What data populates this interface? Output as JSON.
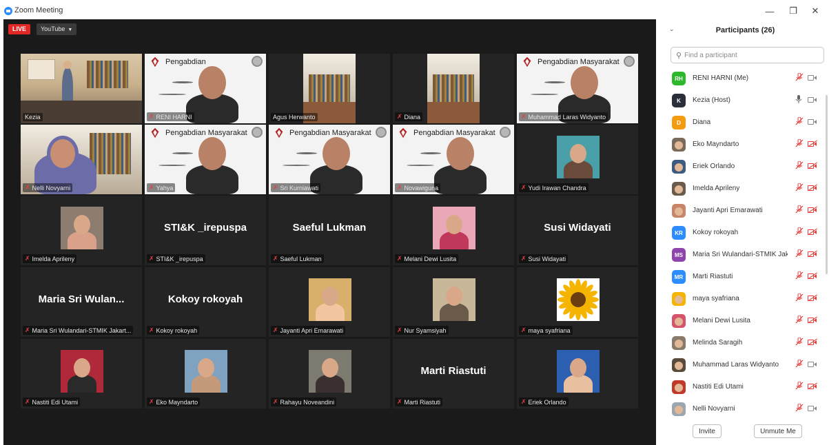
{
  "window": {
    "title": "Zoom Meeting"
  },
  "meeting": {
    "live_label": "LIVE",
    "stream_target": "YouTube"
  },
  "tiles": [
    {
      "name": "Kezia",
      "kind": "video-room",
      "muted": false,
      "active": true
    },
    {
      "name": "RENI HARNI",
      "kind": "banner",
      "muted": true,
      "banner": "Pengabdian"
    },
    {
      "name": "Agus Herwanto",
      "kind": "video-library",
      "muted": false
    },
    {
      "name": "Diana",
      "kind": "video-library2",
      "muted": true
    },
    {
      "name": "Muhammad Laras Widyanto",
      "kind": "banner",
      "muted": true,
      "banner": "Pengabdian Masyarakat"
    },
    {
      "name": "Nelli Novyarni",
      "kind": "video-home",
      "muted": true
    },
    {
      "name": "Yahya",
      "kind": "banner",
      "muted": true,
      "banner": "Pengabdian Masyarakat"
    },
    {
      "name": "Sri Kurniawati",
      "kind": "banner",
      "muted": true,
      "banner": "Pengabdian Masyarakat"
    },
    {
      "name": "Novawiguna",
      "kind": "banner",
      "muted": true,
      "banner": "Pengabdian Masyarakat"
    },
    {
      "name": "Yudi Irawan Chandra",
      "kind": "photo",
      "muted": true
    },
    {
      "name": "Imelda Aprileny",
      "kind": "photo",
      "muted": true
    },
    {
      "name": "STI&K _irepuspa",
      "kind": "text",
      "muted": true,
      "big": "STI&K _irepuspa"
    },
    {
      "name": "Saeful Lukman",
      "kind": "text",
      "muted": true,
      "big": "Saeful Lukman"
    },
    {
      "name": "Melani Dewi Lusita",
      "kind": "photo",
      "muted": true
    },
    {
      "name": "Susi Widayati",
      "kind": "text",
      "muted": true,
      "big": "Susi Widayati"
    },
    {
      "name": "Maria Sri Wulandari-STMIK Jakart...",
      "kind": "text",
      "muted": true,
      "big": "Maria Sri Wulan..."
    },
    {
      "name": "Kokoy rokoyah",
      "kind": "text",
      "muted": true,
      "big": "Kokoy rokoyah"
    },
    {
      "name": "Jayanti Apri Emarawati",
      "kind": "photo",
      "muted": true
    },
    {
      "name": "Nur Syamsiyah",
      "kind": "photo",
      "muted": true
    },
    {
      "name": "maya syafriana",
      "kind": "photo-flower",
      "muted": true
    },
    {
      "name": "Nastiti Edi Utami",
      "kind": "photo",
      "muted": true
    },
    {
      "name": "Eko Mayndarto",
      "kind": "photo",
      "muted": true
    },
    {
      "name": "Rahayu Noveandini",
      "kind": "photo",
      "muted": true
    },
    {
      "name": "Marti Riastuti",
      "kind": "text",
      "muted": true,
      "big": "Marti Riastuti"
    },
    {
      "name": "Eriek Orlando",
      "kind": "photo",
      "muted": true
    }
  ],
  "panel": {
    "title": "Participants (26)",
    "search_placeholder": "Find a participant",
    "invite_label": "Invite",
    "unmute_label": "Unmute Me",
    "participants": [
      {
        "name": "RENI HARNI (Me)",
        "initials": "RH",
        "color": "#2eb82e",
        "muted": true,
        "video": true
      },
      {
        "name": "Kezia (Host)",
        "initials": "K",
        "color": "#2b2f3a",
        "muted": false,
        "video": true
      },
      {
        "name": "Diana",
        "initials": "D",
        "color": "#f39c12",
        "muted": true,
        "video": true
      },
      {
        "name": "Eko Mayndarto",
        "initials": "",
        "color": "#7a6a5a",
        "muted": true,
        "video": false
      },
      {
        "name": "Eriek Orlando",
        "initials": "",
        "color": "#3d5a80",
        "muted": true,
        "video": false
      },
      {
        "name": "Imelda Aprileny",
        "initials": "",
        "color": "#6b5b4b",
        "muted": true,
        "video": false
      },
      {
        "name": "Jayanti Apri Emarawati",
        "initials": "",
        "color": "#c9856a",
        "muted": true,
        "video": false
      },
      {
        "name": "Kokoy rokoyah",
        "initials": "KR",
        "color": "#2d8cff",
        "muted": true,
        "video": false
      },
      {
        "name": "Maria Sri Wulandari-STMIK Jakar...",
        "initials": "MS",
        "color": "#8e44ad",
        "muted": true,
        "video": false
      },
      {
        "name": "Marti Riastuti",
        "initials": "MR",
        "color": "#2d8cff",
        "muted": true,
        "video": false
      },
      {
        "name": "maya syafriana",
        "initials": "",
        "color": "#f4b400",
        "muted": true,
        "video": false
      },
      {
        "name": "Melani Dewi Lusita",
        "initials": "",
        "color": "#d6546b",
        "muted": true,
        "video": false
      },
      {
        "name": "Melinda Saragih",
        "initials": "",
        "color": "#8a7a6a",
        "muted": true,
        "video": false
      },
      {
        "name": "Muhammad Laras Widyanto",
        "initials": "",
        "color": "#5a4a3a",
        "muted": true,
        "video": true
      },
      {
        "name": "Nastiti Edi Utami",
        "initials": "",
        "color": "#c0392b",
        "muted": true,
        "video": false
      },
      {
        "name": "Nelli Novyarni",
        "initials": "",
        "color": "#9aa7b0",
        "muted": true,
        "video": true
      }
    ]
  },
  "colors": {
    "live": "#e02828",
    "active_speaker": "#c8e34e",
    "muted": "#e53935",
    "zoom_blue": "#2d8cff"
  }
}
